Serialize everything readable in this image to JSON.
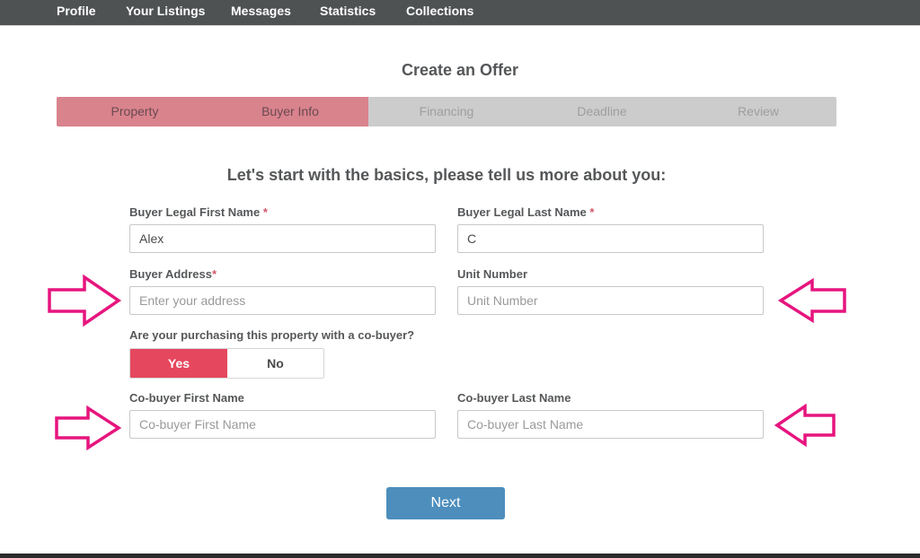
{
  "nav": {
    "items": [
      "Profile",
      "Your Listings",
      "Messages",
      "Statistics",
      "Collections"
    ]
  },
  "page": {
    "title": "Create an Offer",
    "subtitle": "Let's start with the basics, please tell us more about you:"
  },
  "stepper": {
    "steps": [
      {
        "label": "Property",
        "state": "complete"
      },
      {
        "label": "Buyer Info",
        "state": "current"
      },
      {
        "label": "Financing",
        "state": "upcoming"
      },
      {
        "label": "Deadline",
        "state": "upcoming"
      },
      {
        "label": "Review",
        "state": "upcoming"
      }
    ],
    "colors": {
      "active": "#d9838d",
      "inactive": "#cccccc"
    }
  },
  "form": {
    "first_name": {
      "label": "Buyer Legal First Name",
      "required_mark": "*",
      "value": "Alex",
      "placeholder": ""
    },
    "last_name": {
      "label": "Buyer Legal Last Name",
      "required_mark": "*",
      "value": "C",
      "placeholder": ""
    },
    "address": {
      "label": "Buyer Address",
      "required_mark": "*",
      "value": "",
      "placeholder": "Enter your address"
    },
    "unit": {
      "label": "Unit Number",
      "value": "",
      "placeholder": "Unit Number"
    },
    "cobuyer_question": "Are your purchasing this property with a co-buyer?",
    "cobuyer_toggle": {
      "yes_label": "Yes",
      "no_label": "No",
      "selected": "Yes"
    },
    "cobuyer_first": {
      "label": "Co-buyer First Name",
      "value": "",
      "placeholder": "Co-buyer First Name"
    },
    "cobuyer_last": {
      "label": "Co-buyer Last Name",
      "value": "",
      "placeholder": "Co-buyer Last Name"
    },
    "next_label": "Next"
  },
  "annotations": {
    "arrow_color": "#e6157e",
    "arrows": [
      {
        "icon": "arrow-right-icon",
        "points_to": "address"
      },
      {
        "icon": "arrow-left-icon",
        "points_to": "unit"
      },
      {
        "icon": "arrow-right-icon",
        "points_to": "cobuyer_first"
      },
      {
        "icon": "arrow-left-icon",
        "points_to": "cobuyer_last"
      }
    ]
  }
}
